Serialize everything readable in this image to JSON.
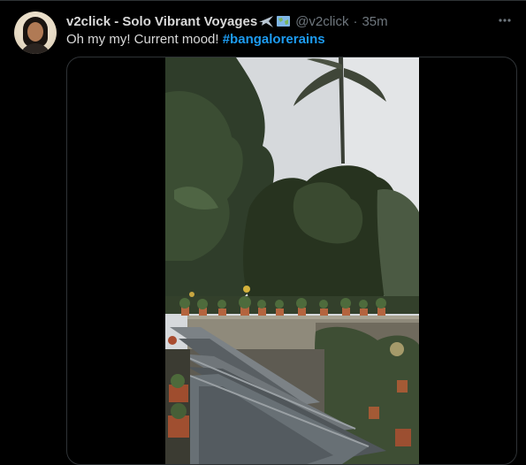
{
  "tweet": {
    "display_name": "v2click - Solo Vibrant Voyages",
    "handle": "@v2click",
    "separator": "·",
    "timestamp": "35m",
    "more_icon": "more-horizontal-icon",
    "text_prefix": "Oh my my! Current mood! ",
    "hashtag": "#bangalorerains",
    "colors": {
      "background": "#000000",
      "text": "#d9d9d9",
      "muted": "#6e767d",
      "link": "#1d9bf0",
      "border": "#2f3336"
    }
  },
  "media": {
    "type": "video",
    "scene": "garden-rain-video-frame"
  }
}
